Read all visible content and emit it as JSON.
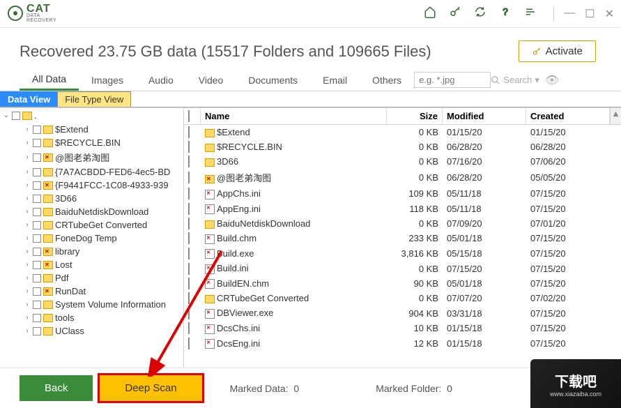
{
  "app": {
    "logo_main": "CAT",
    "logo_sub1": "DATA",
    "logo_sub2": "RECOVERY"
  },
  "header": {
    "title": "Recovered 23.75 GB data (15517 Folders and 109665 Files)",
    "activate_label": "Activate"
  },
  "filters": {
    "tabs": [
      "All Data",
      "Images",
      "Audio",
      "Video",
      "Documents",
      "Email",
      "Others"
    ],
    "search_placeholder": "e.g. *.jpg",
    "search_label": "Search"
  },
  "view_tabs": {
    "data_view": "Data View",
    "file_type_view": "File Type View"
  },
  "tree": {
    "root": ".",
    "items": [
      {
        "label": "$Extend",
        "x": false
      },
      {
        "label": "$RECYCLE.BIN",
        "x": false
      },
      {
        "label": "@图老弟淘图",
        "x": true
      },
      {
        "label": "{7A7ACBDD-FED6-4ec5-BD",
        "x": false
      },
      {
        "label": "{F9441FCC-1C08-4933-939",
        "x": true
      },
      {
        "label": "3D66",
        "x": false
      },
      {
        "label": "BaiduNetdiskDownload",
        "x": false
      },
      {
        "label": "CRTubeGet Converted",
        "x": false
      },
      {
        "label": "FoneDog Temp",
        "x": false
      },
      {
        "label": "library",
        "x": true
      },
      {
        "label": "Lost",
        "x": true
      },
      {
        "label": "Pdf",
        "x": false
      },
      {
        "label": "RunDat",
        "x": true
      },
      {
        "label": "System Volume Information",
        "x": false
      },
      {
        "label": "tools",
        "x": false
      },
      {
        "label": "UClass",
        "x": false
      }
    ]
  },
  "list": {
    "columns": {
      "name": "Name",
      "size": "Size",
      "modified": "Modified",
      "created": "Created"
    },
    "rows": [
      {
        "name": "$Extend",
        "type": "folder",
        "x": false,
        "size": "0 KB",
        "modified": "01/15/20",
        "created": "01/15/20"
      },
      {
        "name": "$RECYCLE.BIN",
        "type": "folder",
        "x": false,
        "size": "0 KB",
        "modified": "06/28/20",
        "created": "06/28/20"
      },
      {
        "name": "3D66",
        "type": "folder",
        "x": false,
        "size": "0 KB",
        "modified": "07/16/20",
        "created": "07/06/20"
      },
      {
        "name": "@图老弟淘图",
        "type": "folder",
        "x": true,
        "size": "0 KB",
        "modified": "06/28/20",
        "created": "05/05/20"
      },
      {
        "name": "AppChs.ini",
        "type": "file",
        "x": true,
        "size": "109 KB",
        "modified": "05/11/18",
        "created": "07/15/20"
      },
      {
        "name": "AppEng.ini",
        "type": "file",
        "x": true,
        "size": "118 KB",
        "modified": "05/11/18",
        "created": "07/15/20"
      },
      {
        "name": "BaiduNetdiskDownload",
        "type": "folder",
        "x": false,
        "size": "0 KB",
        "modified": "07/09/20",
        "created": "07/01/20"
      },
      {
        "name": "Build.chm",
        "type": "file",
        "x": true,
        "size": "233 KB",
        "modified": "05/01/18",
        "created": "07/15/20"
      },
      {
        "name": "Build.exe",
        "type": "file",
        "x": true,
        "size": "3,816 KB",
        "modified": "05/15/18",
        "created": "07/15/20"
      },
      {
        "name": "Build.ini",
        "type": "file",
        "x": true,
        "size": "0 KB",
        "modified": "07/15/20",
        "created": "07/15/20"
      },
      {
        "name": "BuildEN.chm",
        "type": "file",
        "x": true,
        "size": "90 KB",
        "modified": "05/01/18",
        "created": "07/15/20"
      },
      {
        "name": "CRTubeGet Converted",
        "type": "folder",
        "x": false,
        "size": "0 KB",
        "modified": "07/07/20",
        "created": "07/02/20"
      },
      {
        "name": "DBViewer.exe",
        "type": "file",
        "x": true,
        "size": "904 KB",
        "modified": "03/31/18",
        "created": "07/15/20"
      },
      {
        "name": "DcsChs.ini",
        "type": "file",
        "x": true,
        "size": "10 KB",
        "modified": "01/15/18",
        "created": "07/15/20"
      },
      {
        "name": "DcsEng.ini",
        "type": "file",
        "x": true,
        "size": "12 KB",
        "modified": "01/15/18",
        "created": "07/15/20"
      }
    ]
  },
  "footer": {
    "back": "Back",
    "deep_scan": "Deep Scan",
    "marked_data": "Marked Data:",
    "marked_data_val": "0",
    "marked_folder": "Marked Folder:",
    "marked_folder_val": "0",
    "marked": "Marked"
  },
  "watermark": {
    "text": "下载吧",
    "url": "www.xiazaiba.com"
  }
}
